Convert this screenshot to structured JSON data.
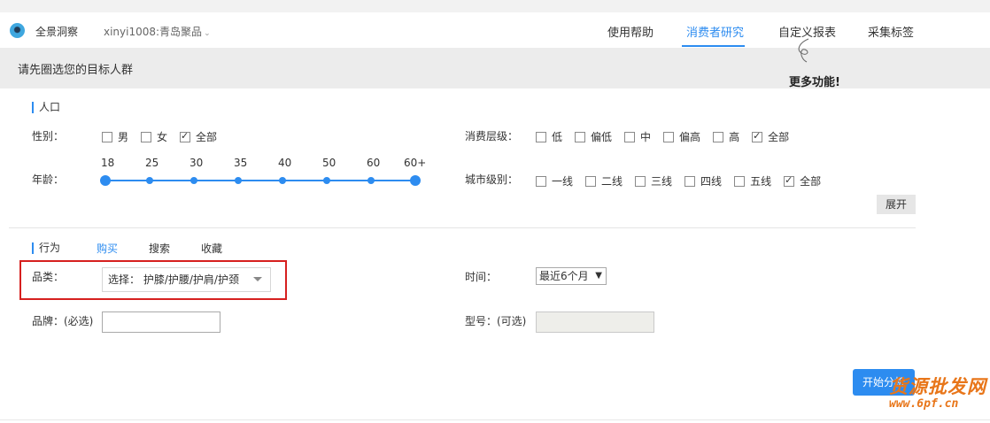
{
  "header": {
    "app_name": "全景洞察",
    "account": "xinyi1008:青岛聚品",
    "nav": [
      "使用帮助",
      "消费者研究",
      "自定义报表",
      "采集标签"
    ],
    "accent": "#2d8cf0"
  },
  "target_bar": {
    "prompt": "请先圈选您的目标人群",
    "more_features": "更多功能!"
  },
  "population": {
    "title": "人口",
    "gender": {
      "label": "性别：",
      "options": [
        {
          "label": "男",
          "checked": false
        },
        {
          "label": "女",
          "checked": false
        },
        {
          "label": "全部",
          "checked": true
        }
      ]
    },
    "age": {
      "label": "年龄：",
      "ticks": [
        "18",
        "25",
        "30",
        "35",
        "40",
        "50",
        "60",
        "60+"
      ]
    },
    "consumption": {
      "label": "消费层级：",
      "options": [
        {
          "label": "低",
          "checked": false
        },
        {
          "label": "偏低",
          "checked": false
        },
        {
          "label": "中",
          "checked": false
        },
        {
          "label": "偏高",
          "checked": false
        },
        {
          "label": "高",
          "checked": false
        },
        {
          "label": "全部",
          "checked": true
        }
      ]
    },
    "city": {
      "label": "城市级别：",
      "options": [
        {
          "label": "一线",
          "checked": false
        },
        {
          "label": "二线",
          "checked": false
        },
        {
          "label": "三线",
          "checked": false
        },
        {
          "label": "四线",
          "checked": false
        },
        {
          "label": "五线",
          "checked": false
        },
        {
          "label": "全部",
          "checked": true
        }
      ]
    },
    "expand_label": "展开"
  },
  "behavior": {
    "title": "行为",
    "tabs": [
      "购买",
      "搜索",
      "收藏"
    ],
    "category_label": "品类：",
    "category_value": "选择：  护膝/护腰/护肩/护颈",
    "time_label": "时间：",
    "time_value": "最近6个月",
    "brand_label": "品牌：(必选)",
    "model_label": "型号：(可选)",
    "start_label": "开始分析"
  },
  "watermark": {
    "line1": "货源批发网",
    "line2": "www.6pf.cn"
  }
}
